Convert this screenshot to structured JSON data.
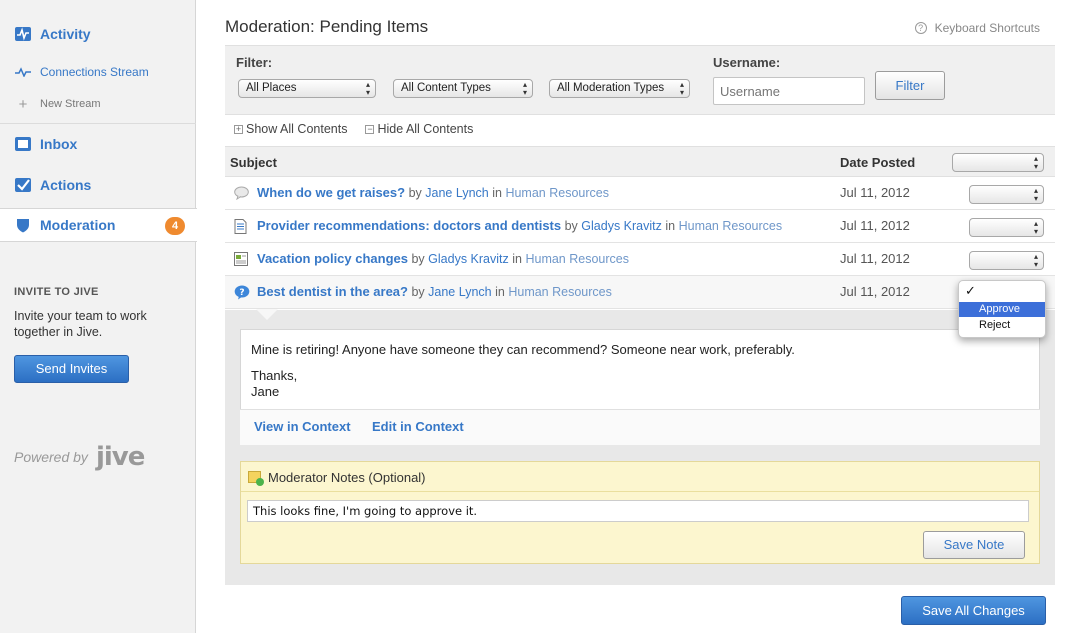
{
  "sidebar": {
    "nav": [
      {
        "label": "Activity",
        "icon": "activity-icon"
      },
      {
        "label": "Inbox",
        "icon": "inbox-icon"
      },
      {
        "label": "Actions",
        "icon": "actions-icon"
      },
      {
        "label": "Moderation",
        "icon": "moderation-shield-icon",
        "badge": "4"
      }
    ],
    "streams": [
      {
        "label": "Connections Stream",
        "icon": "pulse-icon"
      },
      {
        "label": "New Stream",
        "icon": "plus-icon"
      }
    ],
    "invite": {
      "heading": "INVITE TO JIVE",
      "text": "Invite your team to work together in Jive.",
      "button": "Send Invites"
    },
    "powered_by": {
      "label": "Powered by",
      "logo": "jive"
    }
  },
  "page": {
    "title": "Moderation: Pending Items",
    "keyboard_shortcuts": "Keyboard Shortcuts"
  },
  "filter": {
    "label": "Filter:",
    "places": "All Places",
    "content_types": "All Content Types",
    "moderation_types": "All Moderation Types",
    "username_label": "Username:",
    "username_placeholder": "Username",
    "button": "Filter"
  },
  "toggles": {
    "show_all": "Show All Contents",
    "hide_all": "Hide All Contents"
  },
  "table": {
    "col_subject": "Subject",
    "col_date": "Date Posted",
    "rows": [
      {
        "icon": "discussion-icon",
        "title": "When do we get raises?",
        "by": "by",
        "user": "Jane Lynch",
        "in": "in",
        "place": "Human Resources",
        "date": "Jul 11, 2012"
      },
      {
        "icon": "document-icon",
        "title": "Provider recommendations: doctors and dentists",
        "by": "by",
        "user": "Gladys Kravitz",
        "in": "in",
        "place": "Human Resources",
        "date": "Jul 11, 2012"
      },
      {
        "icon": "blogpost-icon",
        "title": "Vacation policy changes",
        "by": "by",
        "user": "Gladys Kravitz",
        "in": "in",
        "place": "Human Resources",
        "date": "Jul 11, 2012"
      },
      {
        "icon": "question-icon",
        "title": "Best dentist in the area?",
        "by": "by",
        "user": "Jane Lynch",
        "in": "in",
        "place": "Human Resources",
        "date": "Jul 11, 2012"
      }
    ]
  },
  "detail": {
    "body_line1": "Mine is retiring! Anyone have someone they can recommend?  Someone near work, preferably.",
    "body_line2": "Thanks,",
    "body_line3": "Jane",
    "view_link": "View in Context",
    "edit_link": "Edit in Context",
    "notes_label": "Moderator Notes (Optional)",
    "notes_value": "This looks fine, I'm going to approve it.",
    "save_note": "Save Note"
  },
  "action_menu": {
    "check": "✓",
    "options": [
      "Approve",
      "Reject"
    ],
    "highlighted": "Approve"
  },
  "save_all": "Save All Changes",
  "colors": {
    "link": "#3778c7",
    "badge": "#ef8a2f",
    "primary_button": "#3a80d0",
    "notes_bg": "#fcf6cf"
  }
}
